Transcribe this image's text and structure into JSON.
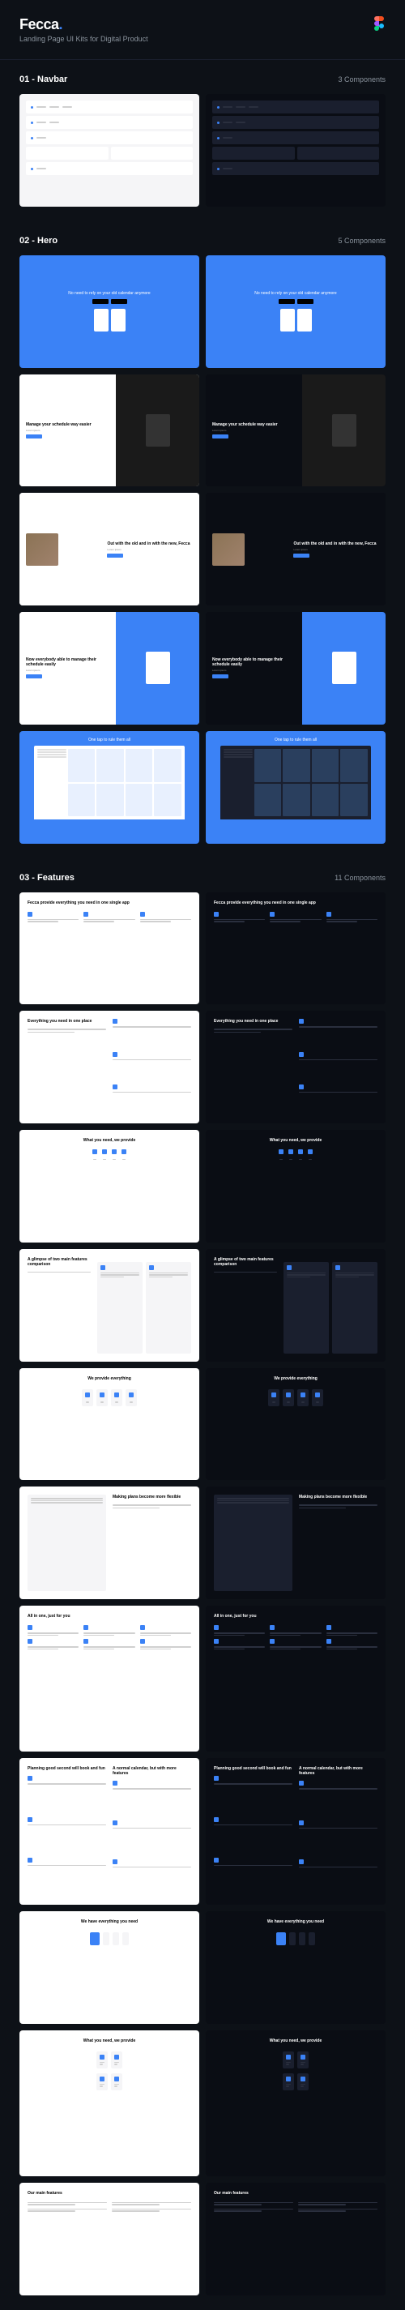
{
  "header": {
    "brand": "Fecca",
    "dot": ".",
    "subtitle": "Landing Page UI Kits for Digital Product"
  },
  "sections": [
    {
      "id": "01",
      "title": "01 - Navbar",
      "count": "3 Components"
    },
    {
      "id": "02",
      "title": "02 - Hero",
      "count": "5 Components"
    },
    {
      "id": "03",
      "title": "03 - Features",
      "count": "11 Components"
    }
  ],
  "hero": {
    "card1": "No need to rely on your old calendar anymore",
    "card2": "Manage your schedule way easier",
    "card3": "Out with the old and in with the new, Fecca",
    "card4": "Now everybody able to manage their schedule easily",
    "card5": "One tap to rule them all"
  },
  "features": {
    "f1": "Fecca provide everything you need in one single app",
    "f2": "Everything you need in one place",
    "f3": "What you need, we provide",
    "f4": "A glimpse of two main features comparison",
    "f5": "We provide everything",
    "f6": "Making plans become more flexible",
    "f7": "All in one, just for you",
    "f8": "Planning good second will book and fun",
    "f9": "A normal calendar, but with more features",
    "f10": "We have everything you need",
    "f11": "What you need, we provide",
    "f12": "Our main features"
  },
  "colors": {
    "accent": "#3b82f6",
    "bg": "#0d1117",
    "light": "#f5f5f7",
    "dark": "#0a0d14"
  }
}
